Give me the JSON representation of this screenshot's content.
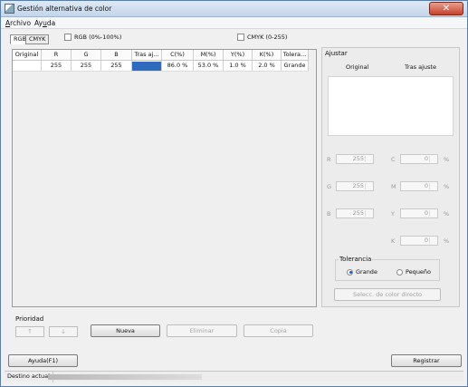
{
  "window": {
    "title": "Gestión alternativa de color",
    "close_label": "✕"
  },
  "menu": [
    {
      "label_u": "A",
      "label_rest": "rchivo"
    },
    {
      "label_pre": "Ay",
      "label_u": "u",
      "label_rest": "da"
    }
  ],
  "tabs": [
    "RGB",
    "CMYK"
  ],
  "options": {
    "rgb_percent": "RGB (0%-100%)",
    "cmyk_range": "CMYK (0-255)"
  },
  "table": {
    "headers": [
      "Original",
      "R",
      "G",
      "B",
      "Tras aj...",
      "C(%)",
      "M(%)",
      "Y(%)",
      "K(%)",
      "Tolera..."
    ],
    "rows": [
      [
        "",
        "255",
        "255",
        "255",
        "",
        "86.0 %",
        "53.0 %",
        "1.0 %",
        "2.0 %",
        "Grande"
      ]
    ],
    "swatch_color": "#2e6bbf"
  },
  "priority": {
    "label": "Prioridad",
    "up": "↑",
    "down": "↓"
  },
  "buttons": {
    "nueva": "Nueva",
    "eliminar": "Eliminar",
    "copia": "Copia",
    "ayuda": "Ayuda(F1)",
    "registrar": "Registrar",
    "direct": "Selecc. de color directo"
  },
  "adjust": {
    "title": "Ajustar",
    "col_original": "Original",
    "col_after": "Tras ajuste",
    "rgb": [
      {
        "label": "R",
        "value": "255"
      },
      {
        "label": "G",
        "value": "255"
      },
      {
        "label": "B",
        "value": "255"
      }
    ],
    "cmyk": [
      {
        "label": "C",
        "value": "0"
      },
      {
        "label": "M",
        "value": "0"
      },
      {
        "label": "Y",
        "value": "0"
      },
      {
        "label": "K",
        "value": "0"
      }
    ],
    "percent": "%"
  },
  "tolerance": {
    "label": "Tolerancia",
    "grande": "Grande",
    "pequeno": "Pequeño",
    "selected": "Grande"
  },
  "status": {
    "label": "Destino actual"
  },
  "colors": {
    "accent": "#2e6bbf",
    "titlebar": "#c4d5ea",
    "close": "#c8412b"
  }
}
